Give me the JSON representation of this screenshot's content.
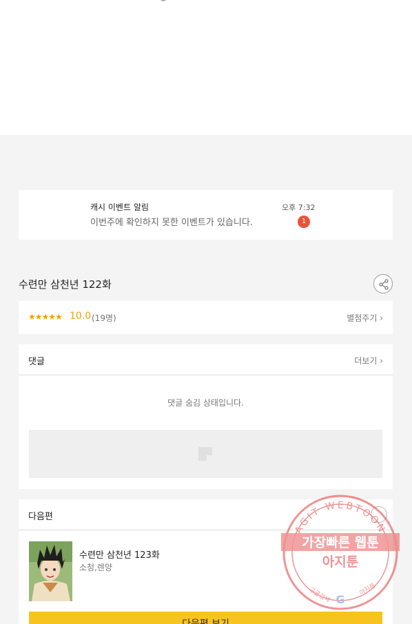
{
  "notification": {
    "title": "캐시 이벤트 알림",
    "message": "이번주에 확인하지 못한 이벤트가 있습니다.",
    "time": "오후 7:32",
    "badge_count": "1"
  },
  "episode": {
    "title": "수련만 삼천년 122화"
  },
  "rating": {
    "stars": "★★★★★",
    "score": "10.0",
    "count": "(19명)",
    "rate_label": "별점주기 ›"
  },
  "comments": {
    "title": "댓글",
    "more_label": "더보기 ›",
    "hidden_message": "댓글 숨김 상태입니다."
  },
  "next_episode": {
    "section_title": "다음편",
    "title": "수련만 삼천년 123화",
    "authors": "소청,렌양",
    "button_label": "다음편 보기"
  },
  "watermark": {
    "arc_text": "AGIT WEBTOON",
    "line1": "가장빠른 웹툰",
    "line2": "아지툰",
    "bottom_left": "구글검색",
    "bottom_right": "아지툰",
    "color": "#e23b3b"
  },
  "colors": {
    "accent_yellow": "#f7c31e",
    "star_orange": "#f5a000",
    "badge_red": "#e8533a"
  }
}
